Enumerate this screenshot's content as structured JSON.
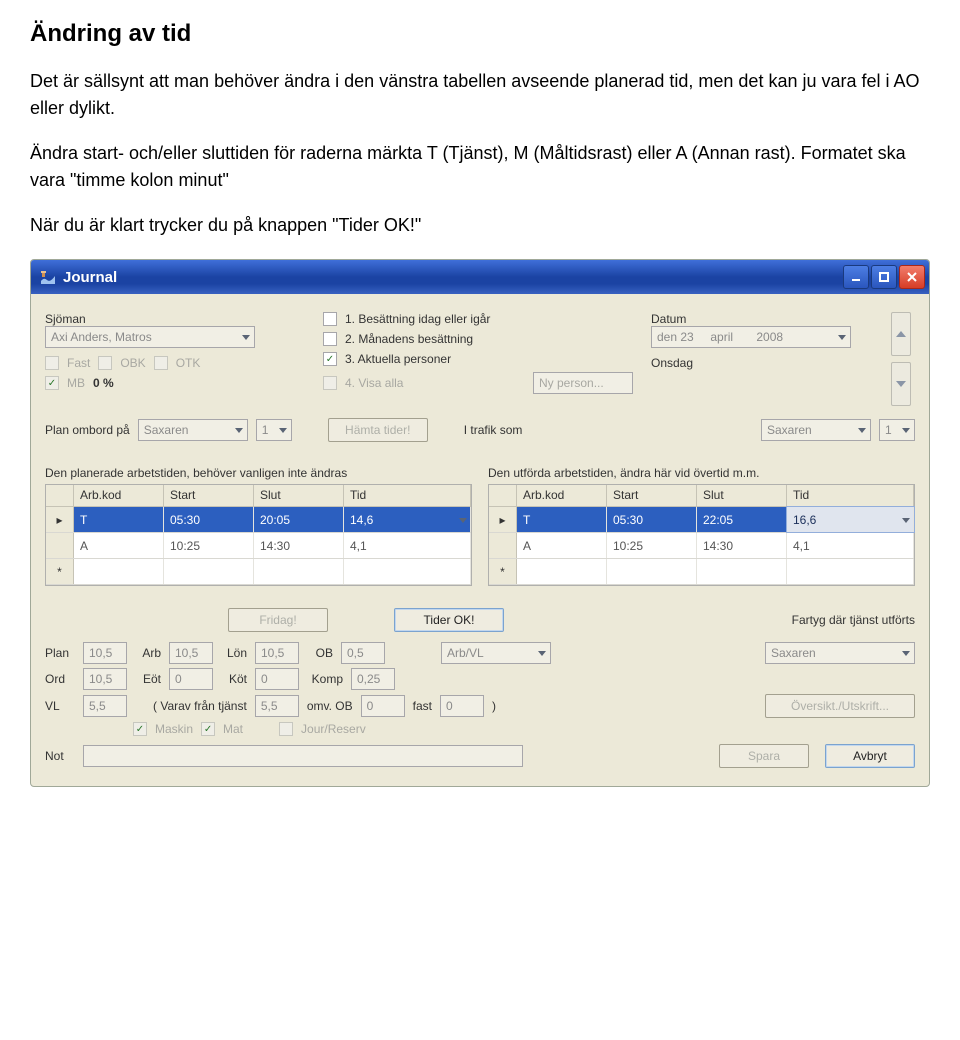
{
  "doc": {
    "h1": "Ändring av tid",
    "p1": "Det är sällsynt att man behöver ändra i den vänstra tabellen avseende planerad tid, men det kan ju vara fel i AO eller dylikt.",
    "p2": "Ändra start- och/eller sluttiden för raderna märkta T (Tjänst), M (Måltidsrast) eller A (Annan rast). Formatet ska vara \"timme kolon minut\"",
    "p3": "När du är klart trycker du på knappen \"Tider OK!\""
  },
  "titlebar": {
    "title": "Journal"
  },
  "top": {
    "sjoman_label": "Sjöman",
    "sjoman_value": "Axi Anders, Matros",
    "fast": "Fast",
    "obk": "OBK",
    "otk": "OTK",
    "mb": "MB",
    "pct": "0 %",
    "opts": {
      "o1": "1. Besättning idag eller igår",
      "o2": "2. Månadens besättning",
      "o3": "3. Aktuella personer",
      "o4": "4. Visa alla"
    },
    "nyperson": "Ny person...",
    "datum_label": "Datum",
    "datum_value": "den 23     april       2008",
    "weekday": "Onsdag"
  },
  "row2": {
    "planombord": "Plan ombord på",
    "saxaren": "Saxaren",
    "one": "1",
    "hamta": "Hämta tider!",
    "itrafik": "I trafik som",
    "saxaren2": "Saxaren",
    "one2": "1"
  },
  "tables": {
    "left_title": "Den planerade arbetstiden, behöver vanligen inte ändras",
    "right_title": "Den utförda arbetstiden, ändra här vid övertid m.m.",
    "headers": {
      "arb": "Arb.kod",
      "start": "Start",
      "slut": "Slut",
      "tid": "Tid"
    },
    "left": [
      {
        "kod": "T",
        "start": "05:30",
        "slut": "20:05",
        "tid": "14,6"
      },
      {
        "kod": "A",
        "start": "10:25",
        "slut": "14:30",
        "tid": "4,1"
      }
    ],
    "right": [
      {
        "kod": "T",
        "start": "05:30",
        "slut": "22:05",
        "tid": "16,6"
      },
      {
        "kod": "A",
        "start": "10:25",
        "slut": "14:30",
        "tid": "4,1"
      }
    ]
  },
  "buttons": {
    "fridag": "Fridag!",
    "tiderok": "Tider OK!",
    "fartyg_label": "Fartyg där tjänst utförts",
    "oversikt": "Översikt./Utskrift...",
    "spara": "Spara",
    "avbryt": "Avbryt"
  },
  "bottom": {
    "plan": "Plan",
    "plan_v": "10,5",
    "arb": "Arb",
    "arb_v": "10,5",
    "lon": "Lön",
    "lon_v": "10,5",
    "ob": "OB",
    "ob_v": "0,5",
    "ord": "Ord",
    "ord_v": "10,5",
    "eot": "Eöt",
    "eot_v": "0",
    "kot": "Köt",
    "kot_v": "0",
    "komp": "Komp",
    "komp_v": "0,25",
    "vl": "VL",
    "vl_v": "5,5",
    "varav": "( Varav från tjänst",
    "varav_v": "5,5",
    "omv": "omv. OB",
    "omv_v": "0",
    "fast": "fast",
    "fast_v": "0",
    "close": ")",
    "arbvl": "Arb/VL",
    "saxaren": "Saxaren",
    "maskin": "Maskin",
    "mat": "Mat",
    "jour": "Jour/Reserv",
    "not": "Not"
  }
}
